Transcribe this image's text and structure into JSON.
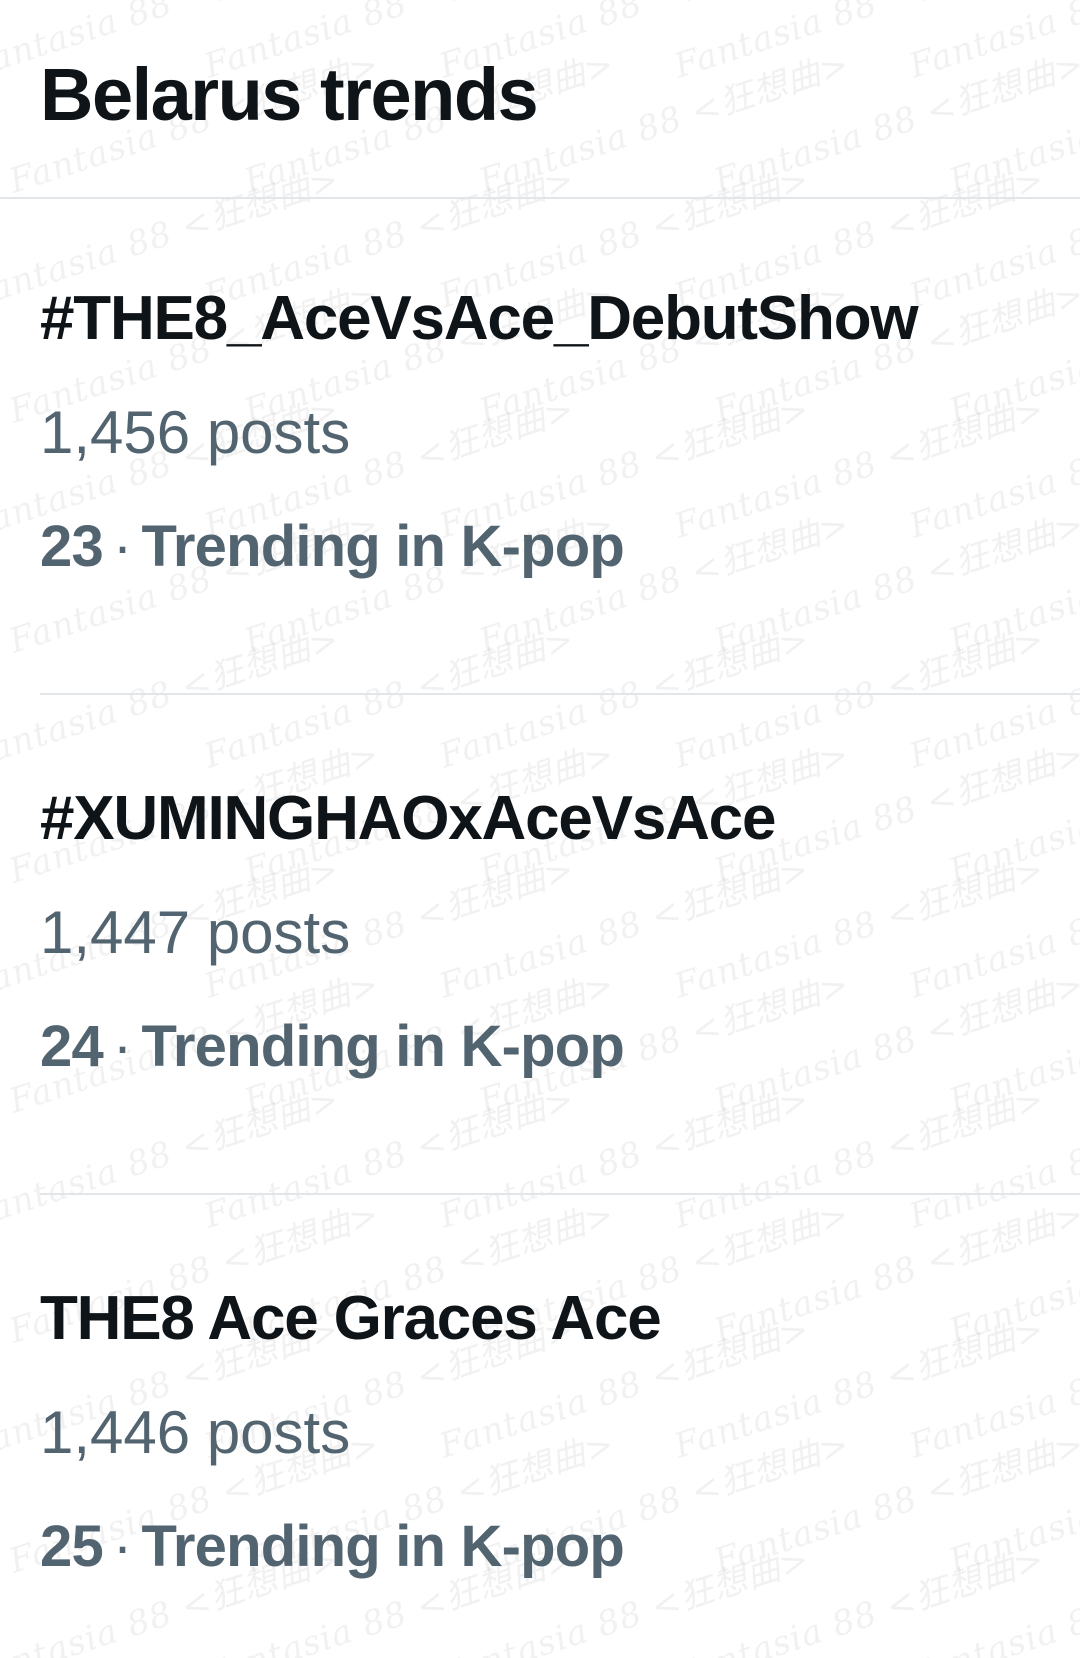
{
  "header": {
    "title": "Belarus trends"
  },
  "trends": [
    {
      "name": "#THE8_AceVsAce_DebutShow",
      "posts": "1,456 posts",
      "rank": "23",
      "separator": "·",
      "context": "Trending in K-pop"
    },
    {
      "name": "#XUMINGHAOxAceVsAce",
      "posts": "1,447 posts",
      "rank": "24",
      "separator": "·",
      "context": "Trending in K-pop"
    },
    {
      "name": "THE8 Ace Graces Ace",
      "posts": "1,446 posts",
      "rank": "25",
      "separator": "·",
      "context": "Trending in K-pop"
    }
  ],
  "watermark": {
    "text": "Fantasia 88 <狂想曲>"
  },
  "colors": {
    "background": "#ffffff",
    "primary_text": "#0f1419",
    "secondary_text": "#536471",
    "divider": "#e3e6e9"
  }
}
